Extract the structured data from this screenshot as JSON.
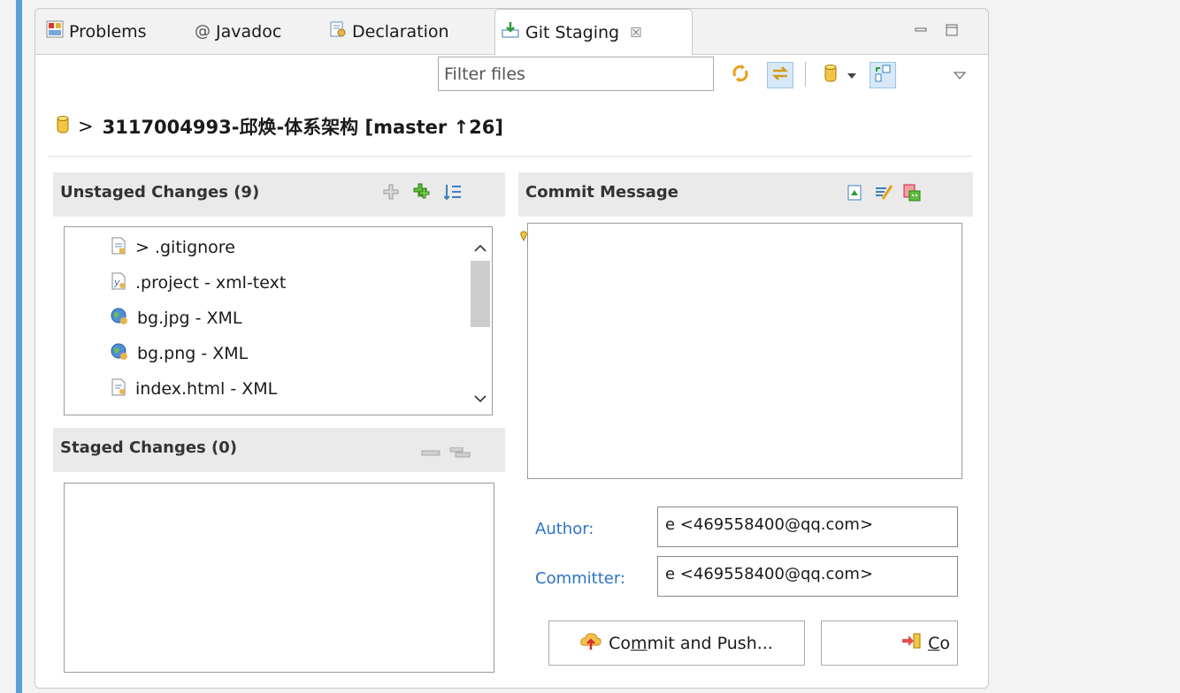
{
  "tabs": [
    {
      "label": "Problems",
      "icon": "problems-icon",
      "active": false
    },
    {
      "label": "Javadoc",
      "icon": "javadoc-icon",
      "active": false
    },
    {
      "label": "Declaration",
      "icon": "declaration-icon",
      "active": false
    },
    {
      "label": "Git Staging",
      "icon": "git-staging-icon",
      "active": true,
      "close": "☒"
    }
  ],
  "toolbar": {
    "filter_placeholder": "Filter files"
  },
  "repo": {
    "prefix": ">",
    "title": "3117004993-邱焕-体系架构 [master ↑26]"
  },
  "unstaged": {
    "header": "Unstaged Changes (9)",
    "files": [
      {
        "label": "> .gitignore",
        "icon": "text-file-icon"
      },
      {
        "label": ".project - xml-text",
        "icon": "xml-file-icon"
      },
      {
        "label": "bg.jpg - XML",
        "icon": "globe-file-icon"
      },
      {
        "label": "bg.png - XML",
        "icon": "globe-file-icon"
      },
      {
        "label": "index.html - XML",
        "icon": "html-file-icon"
      }
    ]
  },
  "staged": {
    "header": "Staged Changes (0)"
  },
  "commit": {
    "header": "Commit Message",
    "author_label": "Author:",
    "author_value": "e <469558400@qq.com>",
    "committer_label": "Committer:",
    "committer_value": "e <469558400@qq.com>",
    "commit_push_pre": "Co",
    "commit_push_mn": "m",
    "commit_push_post": "mit and Push...",
    "commit_mn": "C",
    "commit_rest": "o"
  },
  "colors": {
    "accent": "#5aa0d8",
    "label_blue": "#2c74c7",
    "pressed_bg": "#d7e8f8"
  }
}
